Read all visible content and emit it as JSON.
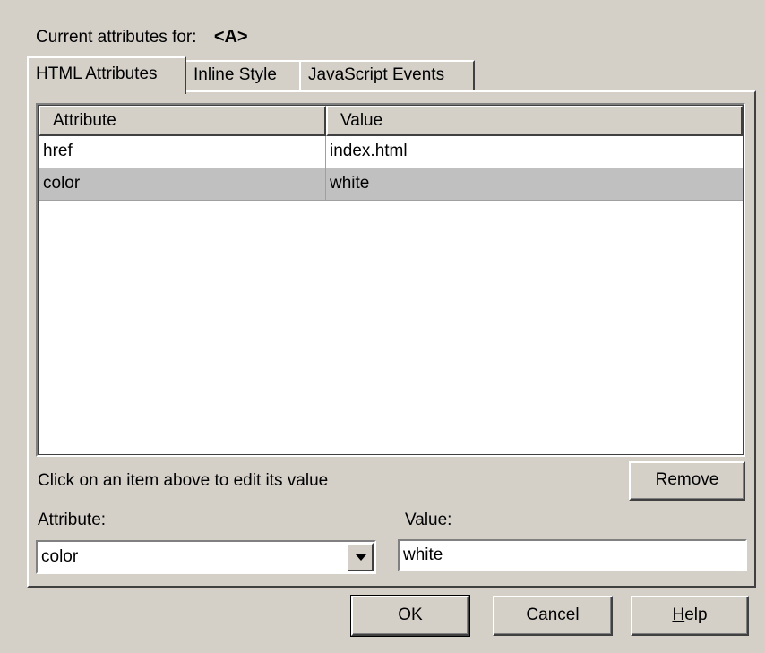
{
  "header": {
    "label": "Current attributes for:",
    "tag": "<A>"
  },
  "tabs": [
    {
      "label": "HTML Attributes",
      "active": true
    },
    {
      "label": "Inline Style",
      "active": false
    },
    {
      "label": "JavaScript Events",
      "active": false
    }
  ],
  "table": {
    "columns": [
      "Attribute",
      "Value"
    ],
    "rows": [
      {
        "attribute": "href",
        "value": "index.html",
        "selected": false
      },
      {
        "attribute": "color",
        "value": "white",
        "selected": true
      }
    ]
  },
  "editor": {
    "hint": "Click on an item above to edit its value",
    "remove_label": "Remove",
    "attribute_label": "Attribute:",
    "attribute_value": "color",
    "value_label": "Value:",
    "value_value": "white"
  },
  "buttons": {
    "ok": "OK",
    "cancel": "Cancel",
    "help_first": "H",
    "help_rest": "elp"
  }
}
